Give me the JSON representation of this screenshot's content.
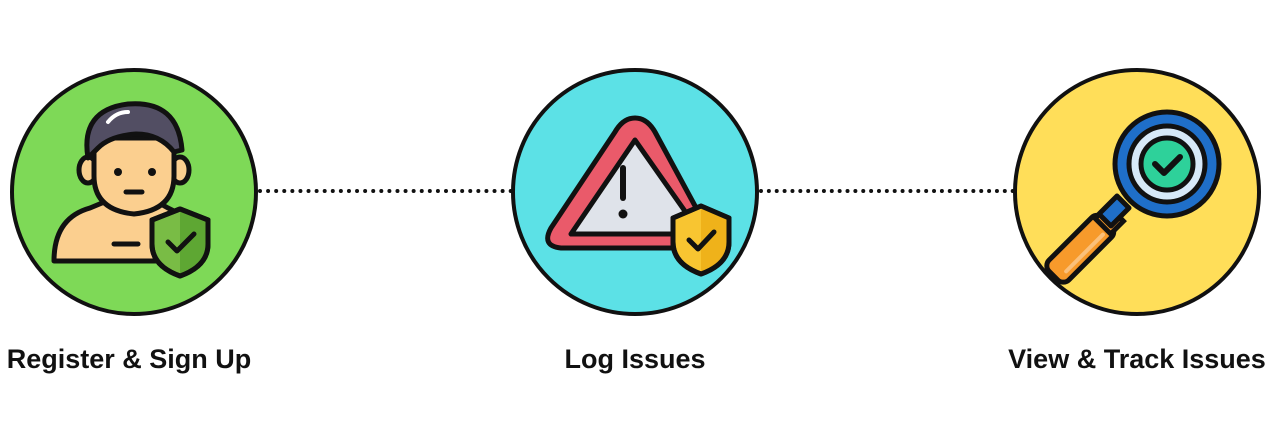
{
  "steps": [
    {
      "label": "Register & Sign Up",
      "icon": "user-shield-icon",
      "circle_color": "#7ed957"
    },
    {
      "label": "Log Issues",
      "icon": "warning-shield-icon",
      "circle_color": "#5ce1e6"
    },
    {
      "label": "View & Track Issues",
      "icon": "magnifier-check-icon",
      "circle_color": "#ffde59"
    }
  ],
  "connector_style": "dotted",
  "colors": {
    "outline": "#111111",
    "shield_green": "#79bc45",
    "shield_yellow": "#f8c531",
    "warning_red": "#ea5a6a",
    "magnifier_blue": "#1f6fc9",
    "handle_orange": "#f79a2b",
    "skin": "#fbcf8f",
    "hair": "#524e63"
  }
}
